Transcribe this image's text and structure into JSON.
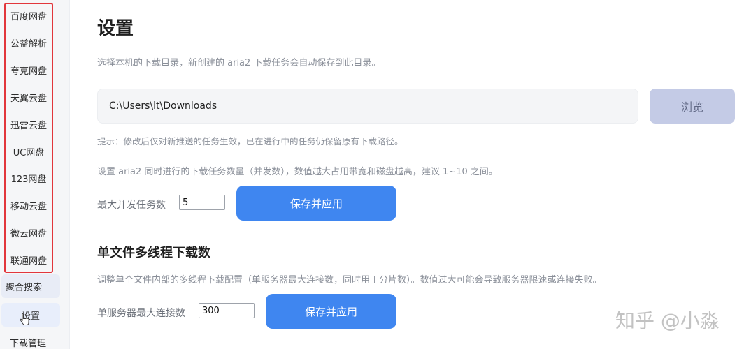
{
  "sidebar": {
    "items": [
      {
        "label": "百度网盘"
      },
      {
        "label": "公益解析"
      },
      {
        "label": "夸克网盘"
      },
      {
        "label": "天翼云盘"
      },
      {
        "label": "迅雷云盘"
      },
      {
        "label": "UC网盘"
      },
      {
        "label": "123网盘"
      },
      {
        "label": "移动云盘"
      },
      {
        "label": "微云网盘"
      },
      {
        "label": "联通网盘"
      },
      {
        "label": "聚合搜索"
      },
      {
        "label": "设置"
      },
      {
        "label": "下载管理"
      }
    ],
    "active": "设置",
    "highlight_color": "#e2363c"
  },
  "main": {
    "title": "设置",
    "dir_desc": "选择本机的下载目录，新创建的 aria2 下载任务会自动保存到此目录。",
    "dir_value": "C:\\Users\\lt\\Downloads",
    "browse_label": "浏览",
    "dir_hint": "提示：修改后仅对新推送的任务生效，已在进行中的任务仍保留原有下载路径。",
    "concurrency_desc": "设置 aria2 同时进行的下载任务数量（并发数），数值越大占用带宽和磁盘越高，建议 1~10 之间。",
    "concurrency_label": "最大并发任务数",
    "concurrency_value": "5",
    "save_label": "保存并应用",
    "thread_section_title": "单文件多线程下载数",
    "thread_desc": "调整单个文件内部的多线程下载配置（单服务器最大连接数，同时用于分片数）。数值过大可能会导致服务器限速或连接失败。",
    "thread_label": "单服务器最大连接数",
    "thread_value": "300",
    "thread_save_label": "保存并应用"
  },
  "watermark": "知乎 @小淼",
  "colors": {
    "primary_button": "#3f86f0",
    "browse_button": "#c4cbe6"
  }
}
